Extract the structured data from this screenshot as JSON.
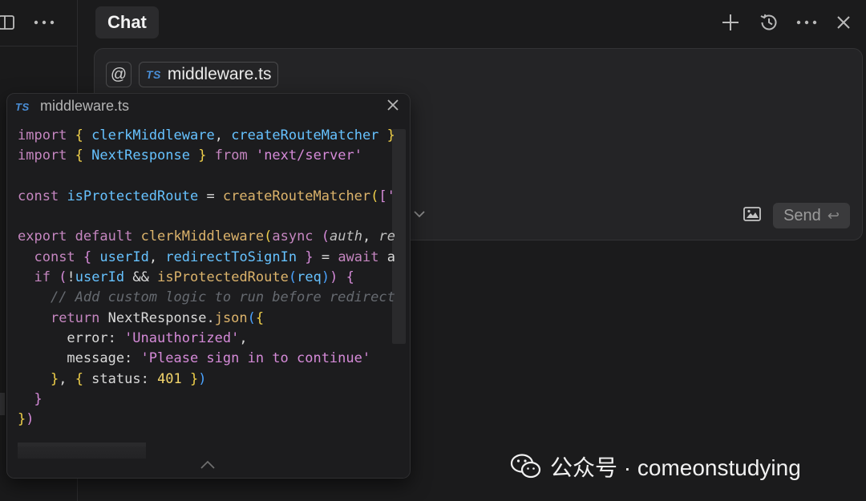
{
  "chat": {
    "title": "Chat"
  },
  "composer": {
    "at_symbol": "@",
    "file_chip": {
      "badge": "TS",
      "name": "middleware.ts"
    },
    "send_label": "Send",
    "send_shortcut": "↩"
  },
  "popup": {
    "badge": "TS",
    "file_name": "middleware.ts",
    "code_lines": [
      [
        [
          "k",
          "import"
        ],
        [
          "p",
          " "
        ],
        [
          "b1",
          "{"
        ],
        [
          "p",
          " "
        ],
        [
          "t",
          "clerkMiddleware"
        ],
        [
          "p",
          ", "
        ],
        [
          "t",
          "createRouteMatcher"
        ],
        [
          "p",
          " "
        ],
        [
          "b1",
          "}"
        ]
      ],
      [
        [
          "k",
          "import"
        ],
        [
          "p",
          " "
        ],
        [
          "b1",
          "{"
        ],
        [
          "p",
          " "
        ],
        [
          "t",
          "NextResponse"
        ],
        [
          "p",
          " "
        ],
        [
          "b1",
          "}"
        ],
        [
          "p",
          " "
        ],
        [
          "k",
          "from"
        ],
        [
          "p",
          " "
        ],
        [
          "s",
          "'next/server'"
        ]
      ],
      [],
      [
        [
          "k",
          "const"
        ],
        [
          "p",
          " "
        ],
        [
          "t",
          "isProtectedRoute"
        ],
        [
          "p",
          " = "
        ],
        [
          "f",
          "createRouteMatcher"
        ],
        [
          "b1",
          "("
        ],
        [
          "b2",
          "["
        ],
        [
          "s",
          "'"
        ]
      ],
      [],
      [
        [
          "k",
          "export"
        ],
        [
          "p",
          " "
        ],
        [
          "k",
          "default"
        ],
        [
          "p",
          " "
        ],
        [
          "f",
          "clerkMiddleware"
        ],
        [
          "b1",
          "("
        ],
        [
          "k",
          "async"
        ],
        [
          "p",
          " "
        ],
        [
          "b2",
          "("
        ],
        [
          "i",
          "auth"
        ],
        [
          "p",
          ", "
        ],
        [
          "i",
          "re"
        ]
      ],
      [
        [
          "p",
          "  "
        ],
        [
          "k",
          "const"
        ],
        [
          "p",
          " "
        ],
        [
          "b2",
          "{"
        ],
        [
          "p",
          " "
        ],
        [
          "t",
          "userId"
        ],
        [
          "p",
          ", "
        ],
        [
          "t",
          "redirectToSignIn"
        ],
        [
          "p",
          " "
        ],
        [
          "b2",
          "}"
        ],
        [
          "p",
          " = "
        ],
        [
          "k",
          "await"
        ],
        [
          "p",
          " a"
        ]
      ],
      [
        [
          "p",
          "  "
        ],
        [
          "k",
          "if"
        ],
        [
          "p",
          " "
        ],
        [
          "b2",
          "("
        ],
        [
          "p",
          "!"
        ],
        [
          "t",
          "userId"
        ],
        [
          "p",
          " && "
        ],
        [
          "f",
          "isProtectedRoute"
        ],
        [
          "b3",
          "("
        ],
        [
          "t",
          "req"
        ],
        [
          "b3",
          ")"
        ],
        [
          "b2",
          ")"
        ],
        [
          "p",
          " "
        ],
        [
          "b2",
          "{"
        ]
      ],
      [
        [
          "p",
          "    "
        ],
        [
          "c",
          "// Add custom logic to run before redirect"
        ]
      ],
      [
        [
          "p",
          "    "
        ],
        [
          "k",
          "return"
        ],
        [
          "p",
          " "
        ],
        [
          "p",
          "NextResponse"
        ],
        [
          "p",
          "."
        ],
        [
          "f",
          "json"
        ],
        [
          "b3",
          "("
        ],
        [
          "b1",
          "{"
        ]
      ],
      [
        [
          "p",
          "      error: "
        ],
        [
          "s",
          "'Unauthorized'"
        ],
        [
          "p",
          ","
        ]
      ],
      [
        [
          "p",
          "      message: "
        ],
        [
          "s",
          "'Please sign in to continue'"
        ]
      ],
      [
        [
          "p",
          "    "
        ],
        [
          "b1",
          "}"
        ],
        [
          "p",
          ", "
        ],
        [
          "b1",
          "{"
        ],
        [
          "p",
          " status: "
        ],
        [
          "n",
          "401"
        ],
        [
          "p",
          " "
        ],
        [
          "b1",
          "}"
        ],
        [
          "b3",
          ")"
        ]
      ],
      [
        [
          "p",
          "  "
        ],
        [
          "b2",
          "}"
        ]
      ],
      [
        [
          "b1",
          "}"
        ],
        [
          "b2",
          ")"
        ]
      ]
    ]
  },
  "watermark": {
    "text": "公众号 · comeonstudying"
  }
}
